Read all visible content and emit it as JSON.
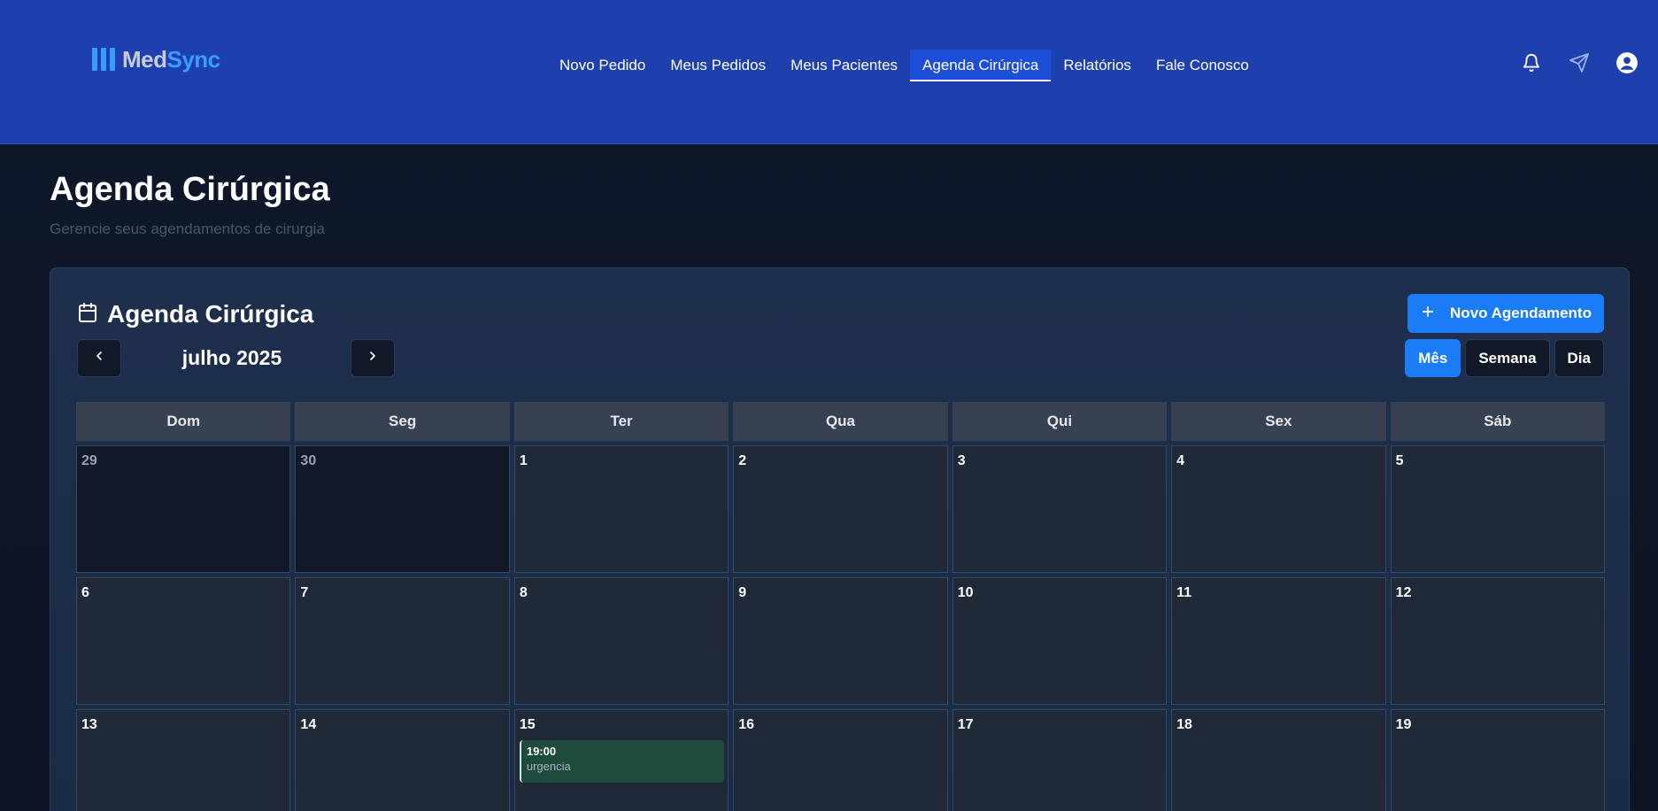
{
  "app": {
    "logo_prefix": "Med",
    "logo_suffix": "Sync"
  },
  "nav": {
    "items": [
      {
        "label": "Novo Pedido",
        "active": false
      },
      {
        "label": "Meus Pedidos",
        "active": false
      },
      {
        "label": "Meus Pacientes",
        "active": false
      },
      {
        "label": "Agenda Cirúrgica",
        "active": true
      },
      {
        "label": "Relatórios",
        "active": false
      },
      {
        "label": "Fale Conosco",
        "active": false
      }
    ],
    "icons": [
      "bell-icon",
      "send-icon",
      "user-icon"
    ]
  },
  "page": {
    "title": "Agenda Cirúrgica",
    "subtitle": "Gerencie seus agendamentos de cirurgia"
  },
  "calendar": {
    "title": "Agenda Cirúrgica",
    "title_icon": "calendar-icon",
    "month_label": "julho 2025",
    "new_button_label": "Novo Agendamento",
    "views": [
      {
        "label": "Mês",
        "active": true
      },
      {
        "label": "Semana",
        "active": false
      },
      {
        "label": "Dia",
        "active": false
      }
    ],
    "weekdays": [
      "Dom",
      "Seg",
      "Ter",
      "Qua",
      "Qui",
      "Sex",
      "Sáb"
    ],
    "days": [
      {
        "num": "29",
        "other": true
      },
      {
        "num": "30",
        "other": true
      },
      {
        "num": "1"
      },
      {
        "num": "2"
      },
      {
        "num": "3"
      },
      {
        "num": "4"
      },
      {
        "num": "5"
      },
      {
        "num": "6"
      },
      {
        "num": "7"
      },
      {
        "num": "8"
      },
      {
        "num": "9"
      },
      {
        "num": "10"
      },
      {
        "num": "11"
      },
      {
        "num": "12"
      },
      {
        "num": "13"
      },
      {
        "num": "14"
      },
      {
        "num": "15",
        "events": [
          {
            "time": "19:00",
            "title": "urgencia"
          }
        ]
      },
      {
        "num": "16"
      },
      {
        "num": "17"
      },
      {
        "num": "18"
      },
      {
        "num": "19"
      }
    ]
  },
  "colors": {
    "header_bg": "#1e40af",
    "accent": "#1a7cf7",
    "page_bg": "#0f172a",
    "event_bg": "#1f4a3e"
  }
}
